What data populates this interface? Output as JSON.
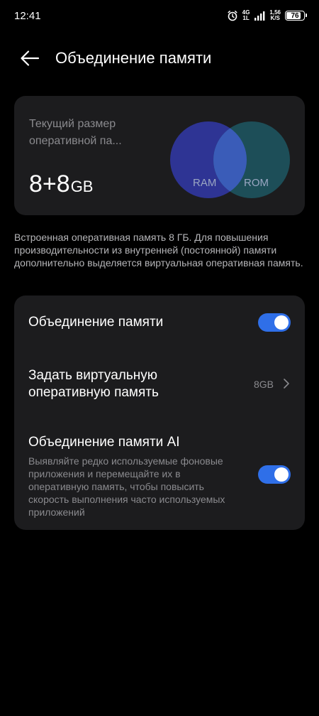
{
  "status_bar": {
    "time": "12:41",
    "network_top": "4G",
    "network_bottom": "1L",
    "speed_top": "1,56",
    "speed_bottom": "K/S",
    "battery": "76",
    "battery_level": 0.76
  },
  "header": {
    "title": "Объединение памяти"
  },
  "info_card": {
    "label": "Текущий размер оперативной па...",
    "value": "8+8",
    "unit": "GB",
    "venn": {
      "left_label": "RAM",
      "right_label": "ROM",
      "left_color": "#2e3494",
      "right_color": "#1d4e58",
      "overlap_color": "#3a5cb8"
    }
  },
  "description": "Встроенная оперативная память 8 ГБ. Для повышения производительности из внутренней (постоянной) памяти дополнительно выделяется виртуальная оперативная память.",
  "settings": {
    "memory_merge": {
      "title": "Объединение памяти",
      "enabled": true
    },
    "virtual_memory": {
      "title_line1": "Задать виртуальную",
      "title_line2": "оперативную память",
      "value": "8GB"
    },
    "ai_merge": {
      "title": "Объединение памяти AI",
      "subtitle": "Выявляйте редко используемые фоновые приложения и перемещайте их в оперативную память, чтобы повысить скорость выполнения часто используемых приложений",
      "enabled": true
    }
  },
  "colors": {
    "background": "#000000",
    "card": "#1c1c1e",
    "accent": "#2f6fe8",
    "secondary_text": "#8a8a8e"
  }
}
